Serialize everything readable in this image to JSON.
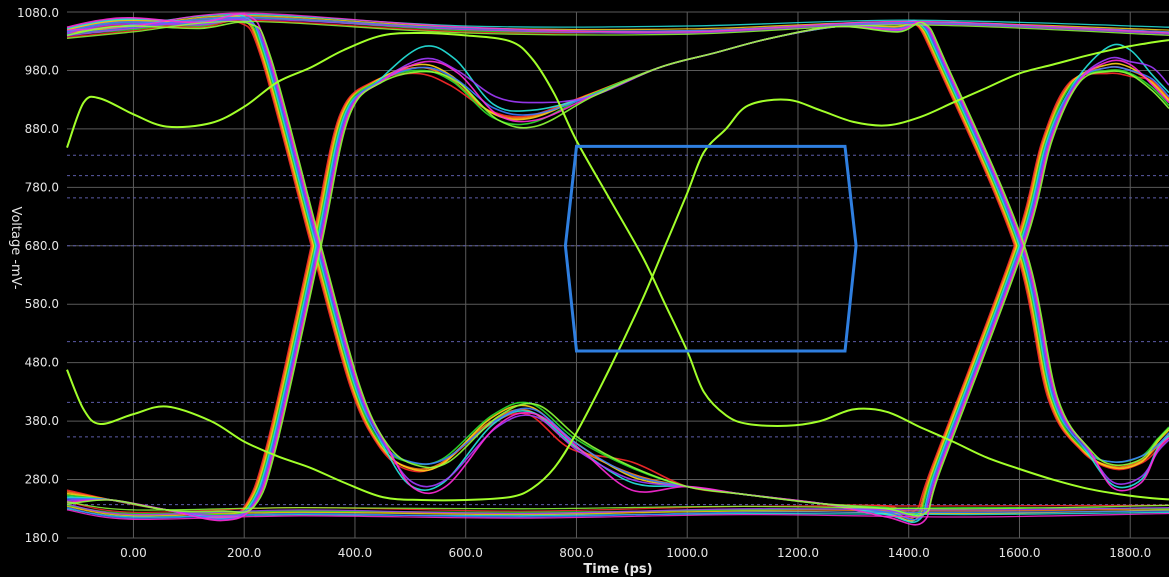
{
  "chart_data": {
    "type": "line",
    "title": "",
    "xlabel": "Time (ps)",
    "ylabel": "Voltage -mV-",
    "xlim": [
      -120,
      1870
    ],
    "ylim": [
      180,
      1080
    ],
    "x_ticks": [
      {
        "value": 0,
        "label": "0.00"
      },
      {
        "value": 200,
        "label": "200.0"
      },
      {
        "value": 400,
        "label": "400.0"
      },
      {
        "value": 600,
        "label": "600.0"
      },
      {
        "value": 800,
        "label": "800.0"
      },
      {
        "value": 1000,
        "label": "1000.0"
      },
      {
        "value": 1200,
        "label": "1200.0"
      },
      {
        "value": 1400,
        "label": "1400.0"
      },
      {
        "value": 1600,
        "label": "1600.0"
      },
      {
        "value": 1800,
        "label": "1800.0"
      }
    ],
    "y_ticks": [
      {
        "value": 180,
        "label": "180.0"
      },
      {
        "value": 280,
        "label": "280.0"
      },
      {
        "value": 380,
        "label": "380.0"
      },
      {
        "value": 480,
        "label": "480.0"
      },
      {
        "value": 580,
        "label": "580.0"
      },
      {
        "value": 680,
        "label": "680.0"
      },
      {
        "value": 780,
        "label": "780.0"
      },
      {
        "value": 880,
        "label": "880.0"
      },
      {
        "value": 980,
        "label": "980.0"
      },
      {
        "value": 1080,
        "label": "1080.0"
      }
    ],
    "grid": true,
    "reference_lines_mV": [
      237,
      353,
      412,
      516,
      680,
      762,
      800,
      835
    ],
    "mask": {
      "color": "#2f7fe0",
      "points": [
        [
          800,
          850
        ],
        [
          1285,
          850
        ],
        [
          1305,
          680
        ],
        [
          1285,
          500
        ],
        [
          800,
          500
        ],
        [
          780,
          680
        ]
      ]
    },
    "eye": {
      "ui_ps": 1270,
      "crossings_ps": [
        330,
        1600
      ],
      "crossing_mV": 680,
      "high_mV": 1058,
      "low_mV": 228
    },
    "series": [
      {
        "color": "#ff2a2a",
        "values": [
          1062,
          1048,
          975,
          902,
          1050,
          1060,
          232,
          222,
          298,
          392,
          310,
          235
        ]
      },
      {
        "color": "#ff7f1a",
        "values": [
          1068,
          1052,
          985,
          900,
          1052,
          1062,
          226,
          218,
          302,
          398,
          290,
          226
        ]
      },
      {
        "color": "#ffd21a",
        "values": [
          1070,
          1055,
          990,
          898,
          1055,
          1063,
          224,
          216,
          300,
          405,
          285,
          222
        ]
      },
      {
        "color": "#2be02b",
        "values": [
          1066,
          1050,
          980,
          890,
          1050,
          1061,
          226,
          220,
          310,
          410,
          300,
          232
        ]
      },
      {
        "color": "#25e8e0",
        "values": [
          1072,
          1058,
          1020,
          912,
          1060,
          1066,
          220,
          214,
          270,
          395,
          275,
          220
        ]
      },
      {
        "color": "#3a7cff",
        "values": [
          1067,
          1054,
          985,
          905,
          1052,
          1062,
          222,
          212,
          310,
          400,
          288,
          224
        ]
      },
      {
        "color": "#a23bff",
        "values": [
          1064,
          1052,
          1000,
          925,
          1048,
          1060,
          228,
          218,
          275,
          388,
          280,
          228
        ]
      },
      {
        "color": "#ff2ad8",
        "values": [
          1074,
          1056,
          995,
          895,
          1050,
          1064,
          218,
          210,
          265,
          392,
          262,
          216
        ]
      },
      {
        "color": "#8fff3a",
        "values": [
          1060,
          1046,
          978,
          885,
          1046,
          1058,
          232,
          226,
          305,
          408,
          302,
          230
        ]
      }
    ],
    "series_value_order": [
      "prev_high",
      "high_left",
      "peak_top",
      "dip_top",
      "high_right",
      "next_high",
      "prev_low",
      "low_left",
      "dip_bottom",
      "peak_bottom",
      "mid_bottom",
      "low_right"
    ],
    "lone_trace": {
      "color": "#a2ff2a",
      "points": [
        [
          -120,
          848
        ],
        [
          -90,
          925
        ],
        [
          -60,
          932
        ],
        [
          0,
          905
        ],
        [
          60,
          884
        ],
        [
          140,
          890
        ],
        [
          200,
          918
        ],
        [
          260,
          960
        ],
        [
          320,
          985
        ],
        [
          380,
          1015
        ],
        [
          450,
          1040
        ],
        [
          520,
          1044
        ],
        [
          600,
          1040
        ],
        [
          680,
          1030
        ],
        [
          720,
          1000
        ],
        [
          760,
          940
        ],
        [
          800,
          860
        ],
        [
          860,
          760
        ],
        [
          920,
          660
        ],
        [
          960,
          580
        ],
        [
          1000,
          500
        ],
        [
          1030,
          430
        ],
        [
          1070,
          390
        ],
        [
          1110,
          375
        ],
        [
          1180,
          372
        ],
        [
          1240,
          380
        ],
        [
          1300,
          400
        ],
        [
          1360,
          396
        ],
        [
          1420,
          370
        ],
        [
          1480,
          345
        ],
        [
          1540,
          318
        ],
        [
          1600,
          298
        ],
        [
          1660,
          280
        ],
        [
          1720,
          265
        ],
        [
          1780,
          255
        ],
        [
          1840,
          248
        ],
        [
          1870,
          246
        ]
      ],
      "points_b": [
        [
          -120,
          468
        ],
        [
          -90,
          400
        ],
        [
          -60,
          375
        ],
        [
          0,
          392
        ],
        [
          60,
          405
        ],
        [
          140,
          380
        ],
        [
          200,
          345
        ],
        [
          260,
          320
        ],
        [
          320,
          300
        ],
        [
          380,
          275
        ],
        [
          450,
          250
        ],
        [
          520,
          245
        ],
        [
          600,
          245
        ],
        [
          680,
          250
        ],
        [
          720,
          265
        ],
        [
          760,
          300
        ],
        [
          800,
          360
        ],
        [
          860,
          470
        ],
        [
          920,
          590
        ],
        [
          960,
          680
        ],
        [
          1000,
          770
        ],
        [
          1030,
          840
        ],
        [
          1070,
          880
        ],
        [
          1110,
          920
        ],
        [
          1180,
          930
        ],
        [
          1240,
          912
        ],
        [
          1300,
          892
        ],
        [
          1360,
          886
        ],
        [
          1420,
          900
        ],
        [
          1480,
          925
        ],
        [
          1540,
          950
        ],
        [
          1600,
          975
        ],
        [
          1660,
          990
        ],
        [
          1720,
          1005
        ],
        [
          1780,
          1018
        ],
        [
          1840,
          1028
        ],
        [
          1870,
          1032
        ]
      ]
    }
  }
}
